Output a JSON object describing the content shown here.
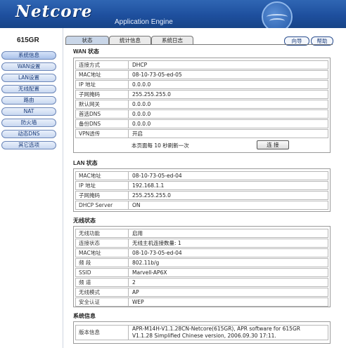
{
  "header": {
    "logo": "Netcore",
    "subtitle": "Application Engine"
  },
  "sidebar": {
    "model": "615GR",
    "items": [
      "系统信息",
      "WAN设置",
      "LAN设置",
      "无线配置",
      "路由",
      "NAT",
      "防火墙",
      "动态DNS",
      "其它选项"
    ]
  },
  "tabs": [
    "状态",
    "统计信息",
    "系统日志"
  ],
  "top_buttons": {
    "guide": "向导",
    "help": "帮助"
  },
  "wan": {
    "title": "WAN 状态",
    "rows": [
      {
        "label": "连接方式",
        "value": "DHCP"
      },
      {
        "label": "MAC地址",
        "value": "08-10-73-05-ed-05"
      },
      {
        "label": "IP  地址",
        "value": "0.0.0.0"
      },
      {
        "label": "子网掩码",
        "value": "255.255.255.0"
      },
      {
        "label": "默认网关",
        "value": "0.0.0.0"
      },
      {
        "label": "首选DNS",
        "value": "0.0.0.0"
      },
      {
        "label": "备份DNS",
        "value": "0.0.0.0"
      },
      {
        "label": "VPN透传",
        "value": "开启"
      }
    ],
    "refresh_text": "本页面每 10 秒刷新一次",
    "refresh_button": "连 接"
  },
  "lan": {
    "title": "LAN 状态",
    "rows": [
      {
        "label": "MAC地址",
        "value": "08-10-73-05-ed-04"
      },
      {
        "label": "IP   地址",
        "value": "192.168.1.1"
      },
      {
        "label": "子网掩码",
        "value": "255.255.255.0"
      },
      {
        "label": "DHCP Server",
        "value": "ON"
      }
    ]
  },
  "wireless": {
    "title": "无线状态",
    "rows": [
      {
        "label": "无线功能",
        "value": "启用"
      },
      {
        "label": "连接状态",
        "value": "无线主机连接数量: 1"
      },
      {
        "label": "MAC地址",
        "value": "08-10-73-05-ed-04"
      },
      {
        "label": "频  段",
        "value": "802.11b/g"
      },
      {
        "label": "SSID",
        "value": "Marvell-AP6X"
      },
      {
        "label": "频  道",
        "value": "2"
      },
      {
        "label": "无线模式",
        "value": "AP"
      },
      {
        "label": "安全认证",
        "value": "WEP"
      }
    ]
  },
  "sysinfo": {
    "title": "系统信息",
    "label": "版本信息",
    "value_line1": "APR-M14H-V1.1.28CN-Netcore(615GR), APR software for 615GR",
    "value_line2": "V1.1.28 Simplified Chinese version, 2006.09.30 17:11."
  }
}
